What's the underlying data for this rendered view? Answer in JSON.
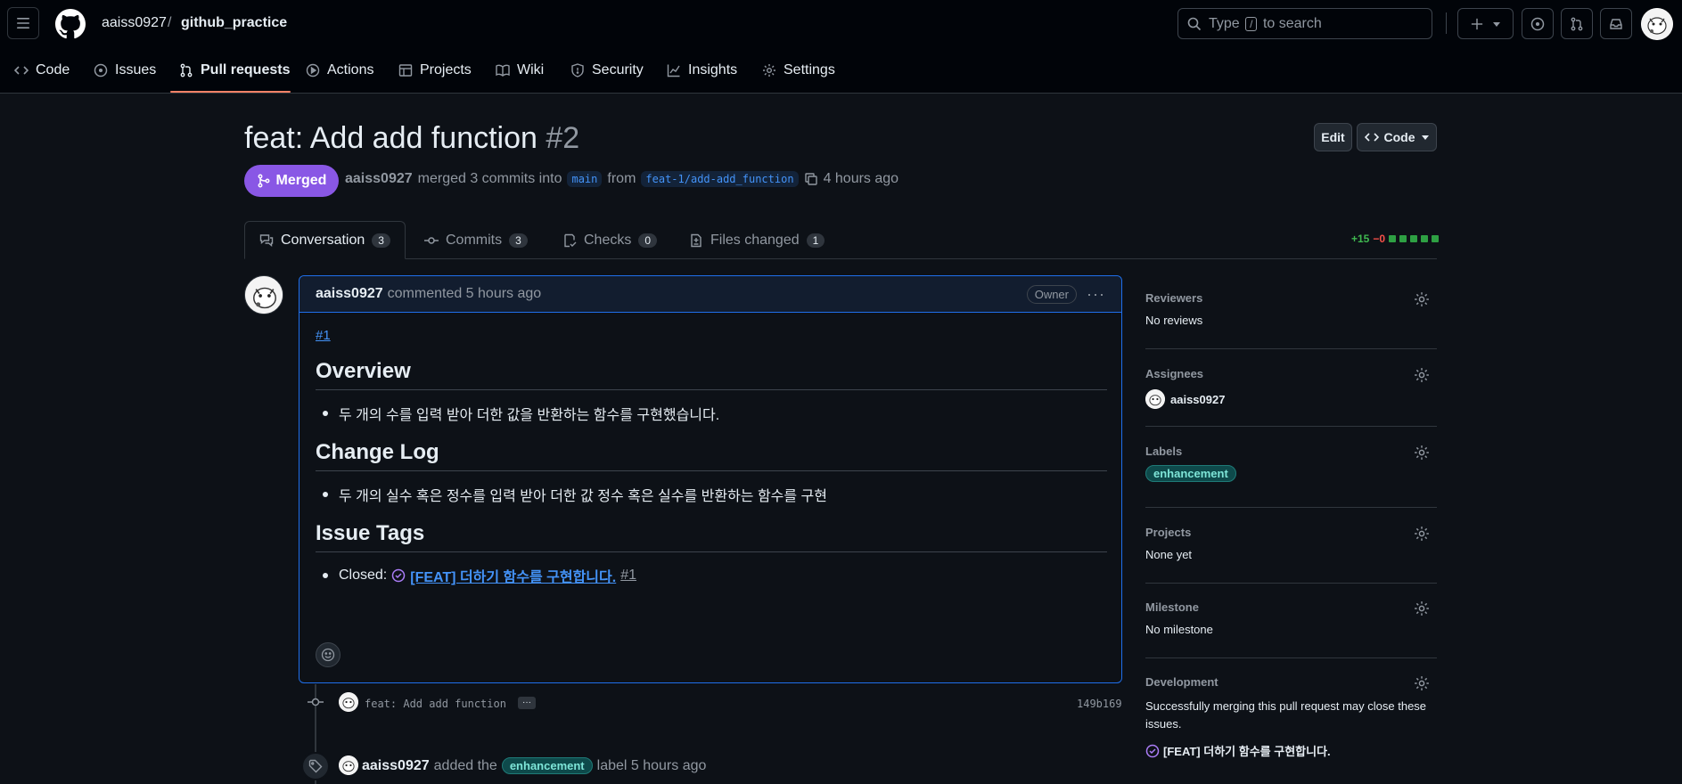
{
  "header": {
    "owner": "aaiss0927",
    "separator": "/",
    "repo": "github_practice",
    "search_prefix": "Type",
    "search_key": "/",
    "search_suffix": "to search"
  },
  "nav": [
    {
      "label": "Code",
      "icon": "code-icon"
    },
    {
      "label": "Issues",
      "icon": "issue-icon"
    },
    {
      "label": "Pull requests",
      "icon": "pull-request-icon"
    },
    {
      "label": "Actions",
      "icon": "play-icon"
    },
    {
      "label": "Projects",
      "icon": "table-icon"
    },
    {
      "label": "Wiki",
      "icon": "book-icon"
    },
    {
      "label": "Security",
      "icon": "shield-icon"
    },
    {
      "label": "Insights",
      "icon": "graph-icon"
    },
    {
      "label": "Settings",
      "icon": "gear-icon"
    }
  ],
  "pr": {
    "title": "feat: Add add function",
    "number": "#2",
    "edit_label": "Edit",
    "code_label": "Code",
    "state": "Merged",
    "author": "aaiss0927",
    "merged_text": "merged 3 commits into",
    "base_branch": "main",
    "from_text": "from",
    "head_branch": "feat-1/add-add_function",
    "time": "4 hours ago"
  },
  "tabs": [
    {
      "label": "Conversation",
      "count": "3"
    },
    {
      "label": "Commits",
      "count": "3"
    },
    {
      "label": "Checks",
      "count": "0"
    },
    {
      "label": "Files changed",
      "count": "1"
    }
  ],
  "diffstat": {
    "additions": "+15",
    "deletions": "−0"
  },
  "comment": {
    "author": "aaiss0927",
    "action": "commented 5 hours ago",
    "badge": "Owner",
    "ref_link": "#1",
    "h_overview": "Overview",
    "overview_item": "두 개의 수를 입력 받아 더한 값을 반환하는 함수를 구현했습니다.",
    "h_changelog": "Change Log",
    "changelog_item": "두 개의 실수 혹은 정수를 입력 받아 더한 값 정수 혹은 실수를 반환하는 함수를 구현",
    "h_issue_tags": "Issue Tags",
    "closed_prefix": "Closed:",
    "closed_issue": "[FEAT] 더하기 함수를 구현합니다.",
    "closed_issue_num": "#1"
  },
  "timeline": {
    "commit_msg": "feat: Add add function",
    "commit_more": "···",
    "commit_sha": "149b169",
    "label_actor": "aaiss0927",
    "label_action": "added the",
    "label_name": "enhancement",
    "label_suffix": "label 5 hours ago"
  },
  "sidebar": {
    "reviewers_h": "Reviewers",
    "reviewers_v": "No reviews",
    "assignees_h": "Assignees",
    "assignee": "aaiss0927",
    "labels_h": "Labels",
    "label": "enhancement",
    "projects_h": "Projects",
    "projects_v": "None yet",
    "milestone_h": "Milestone",
    "milestone_v": "No milestone",
    "development_h": "Development",
    "development_v": "Successfully merging this pull request may close these issues.",
    "development_issue": "[FEAT] 더하기 함수를 구현합니다."
  },
  "colors": {
    "accent": "#4493f8",
    "merged": "#8957e5",
    "underline": "#f78166",
    "additions": "#3fb950",
    "deletions": "#f85149"
  }
}
